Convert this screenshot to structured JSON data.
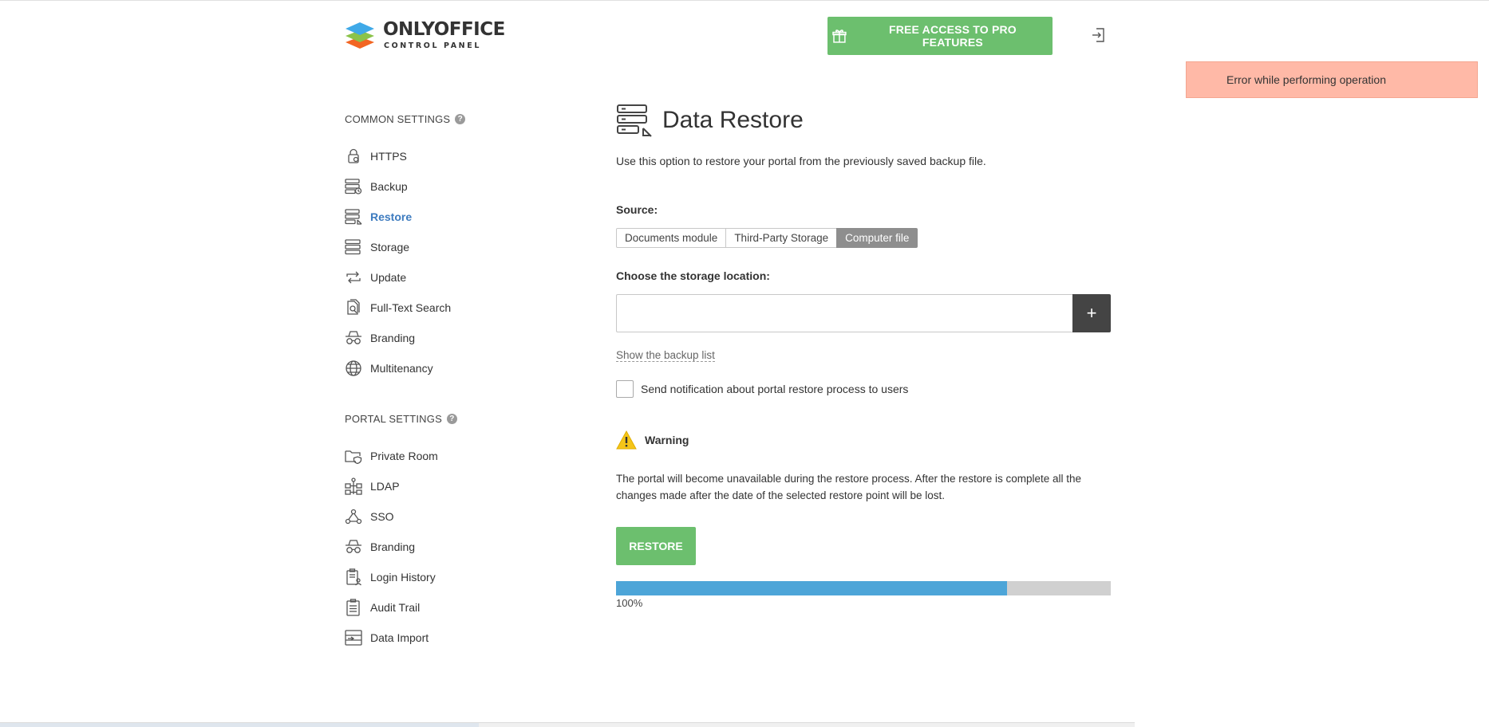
{
  "header": {
    "logo_title": "ONLYOFFICE",
    "logo_subtitle": "CONTROL PANEL",
    "pro_button_label": "FREE ACCESS TO PRO FEATURES"
  },
  "toast": {
    "message": "Error while performing operation"
  },
  "sidebar": {
    "common_title": "COMMON SETTINGS",
    "common_items": [
      {
        "label": "HTTPS",
        "icon": "lock-icon"
      },
      {
        "label": "Backup",
        "icon": "server-clock-icon"
      },
      {
        "label": "Restore",
        "icon": "server-restore-icon",
        "active": true
      },
      {
        "label": "Storage",
        "icon": "storage-icon"
      },
      {
        "label": "Update",
        "icon": "refresh-icon"
      },
      {
        "label": "Full-Text Search",
        "icon": "doc-search-icon"
      },
      {
        "label": "Branding",
        "icon": "incognito-icon"
      },
      {
        "label": "Multitenancy",
        "icon": "globe-icon"
      }
    ],
    "portal_title": "PORTAL SETTINGS",
    "portal_items": [
      {
        "label": "Private Room",
        "icon": "folder-shield-icon"
      },
      {
        "label": "LDAP",
        "icon": "network-icon"
      },
      {
        "label": "SSO",
        "icon": "sso-icon"
      },
      {
        "label": "Branding",
        "icon": "incognito-icon"
      },
      {
        "label": "Login History",
        "icon": "clipboard-user-icon"
      },
      {
        "label": "Audit Trail",
        "icon": "clipboard-icon"
      },
      {
        "label": "Data Import",
        "icon": "data-import-icon"
      }
    ]
  },
  "main": {
    "title": "Data Restore",
    "description": "Use this option to restore your portal from the previously saved backup file.",
    "source_label": "Source:",
    "source_options": [
      "Documents module",
      "Third-Party Storage",
      "Computer file"
    ],
    "source_selected": "Computer file",
    "location_label": "Choose the storage location:",
    "location_value": "",
    "add_label": "+",
    "backup_list_link": "Show the backup list",
    "notify_label": "Send notification about portal restore process to users",
    "notify_checked": false,
    "warning_title": "Warning",
    "warning_text": "The portal will become unavailable during the restore process. After the restore is complete all the changes made after the date of the selected restore point will be lost.",
    "restore_button": "RESTORE",
    "progress_text": "100%",
    "progress_fill_fraction": 0.79
  },
  "colors": {
    "accent_green": "#6cbf6e",
    "active_link": "#3d7bbf",
    "progress_blue": "#4da5d8",
    "toast_bg": "#ffb9a7"
  }
}
